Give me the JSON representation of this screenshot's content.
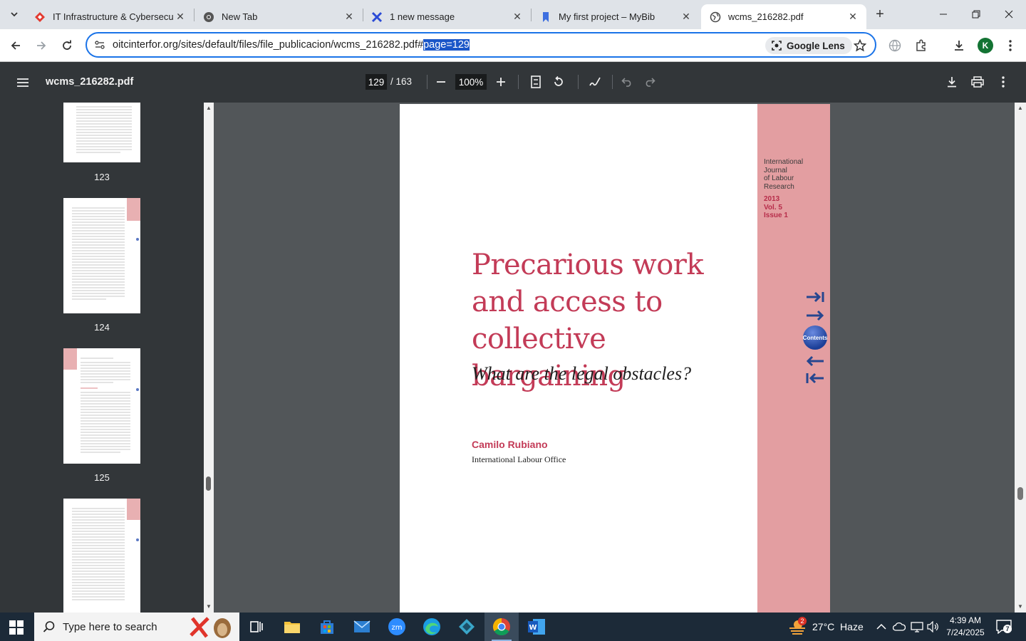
{
  "tabs": [
    {
      "title": "IT Infrastructure & Cybersecurit",
      "favicon": "red-diamond-icon"
    },
    {
      "title": "New Tab",
      "favicon": "chrome-icon"
    },
    {
      "title": "1 new message",
      "favicon": "x-logo-icon"
    },
    {
      "title": "My first project – MyBib",
      "favicon": "bookmark-icon"
    },
    {
      "title": "wcms_216282.pdf",
      "favicon": "globe-icon",
      "active": true
    }
  ],
  "omnibox": {
    "url_main": "oitcinterfor.org/sites/default/files/file_publicacion/wcms_216282.pdf#",
    "url_selected": "page=129",
    "lens_label": "Google Lens"
  },
  "profile": {
    "initial": "K"
  },
  "pdf": {
    "filename": "wcms_216282.pdf",
    "current_page": "129",
    "page_of": "/  163",
    "zoom": "100%"
  },
  "thumbnails": [
    {
      "number": "123"
    },
    {
      "number": "124"
    },
    {
      "number": "125"
    }
  ],
  "page_content": {
    "journal": [
      "International",
      "Journal",
      "of Labour",
      "Research"
    ],
    "issue": [
      "2013",
      "Vol. 5",
      "Issue 1"
    ],
    "title_lines": [
      "Precarious work",
      "and access to collective",
      "bargaining"
    ],
    "subtitle": "What are the legal obstacles?",
    "author": "Camilo Rubiano",
    "affiliation": "International Labour Office",
    "contents_label": "Contents"
  },
  "taskbar": {
    "search_placeholder": "Type here to search",
    "weather": "27°C  Haze",
    "weather_badge": "2",
    "time": "4:39 AM",
    "date": "7/24/2025",
    "notifications": "7"
  },
  "colors": {
    "accent": "#1a73e8",
    "title_red": "#c33b57",
    "band_pink": "#e39ea1",
    "viewer_dark": "#323639"
  }
}
